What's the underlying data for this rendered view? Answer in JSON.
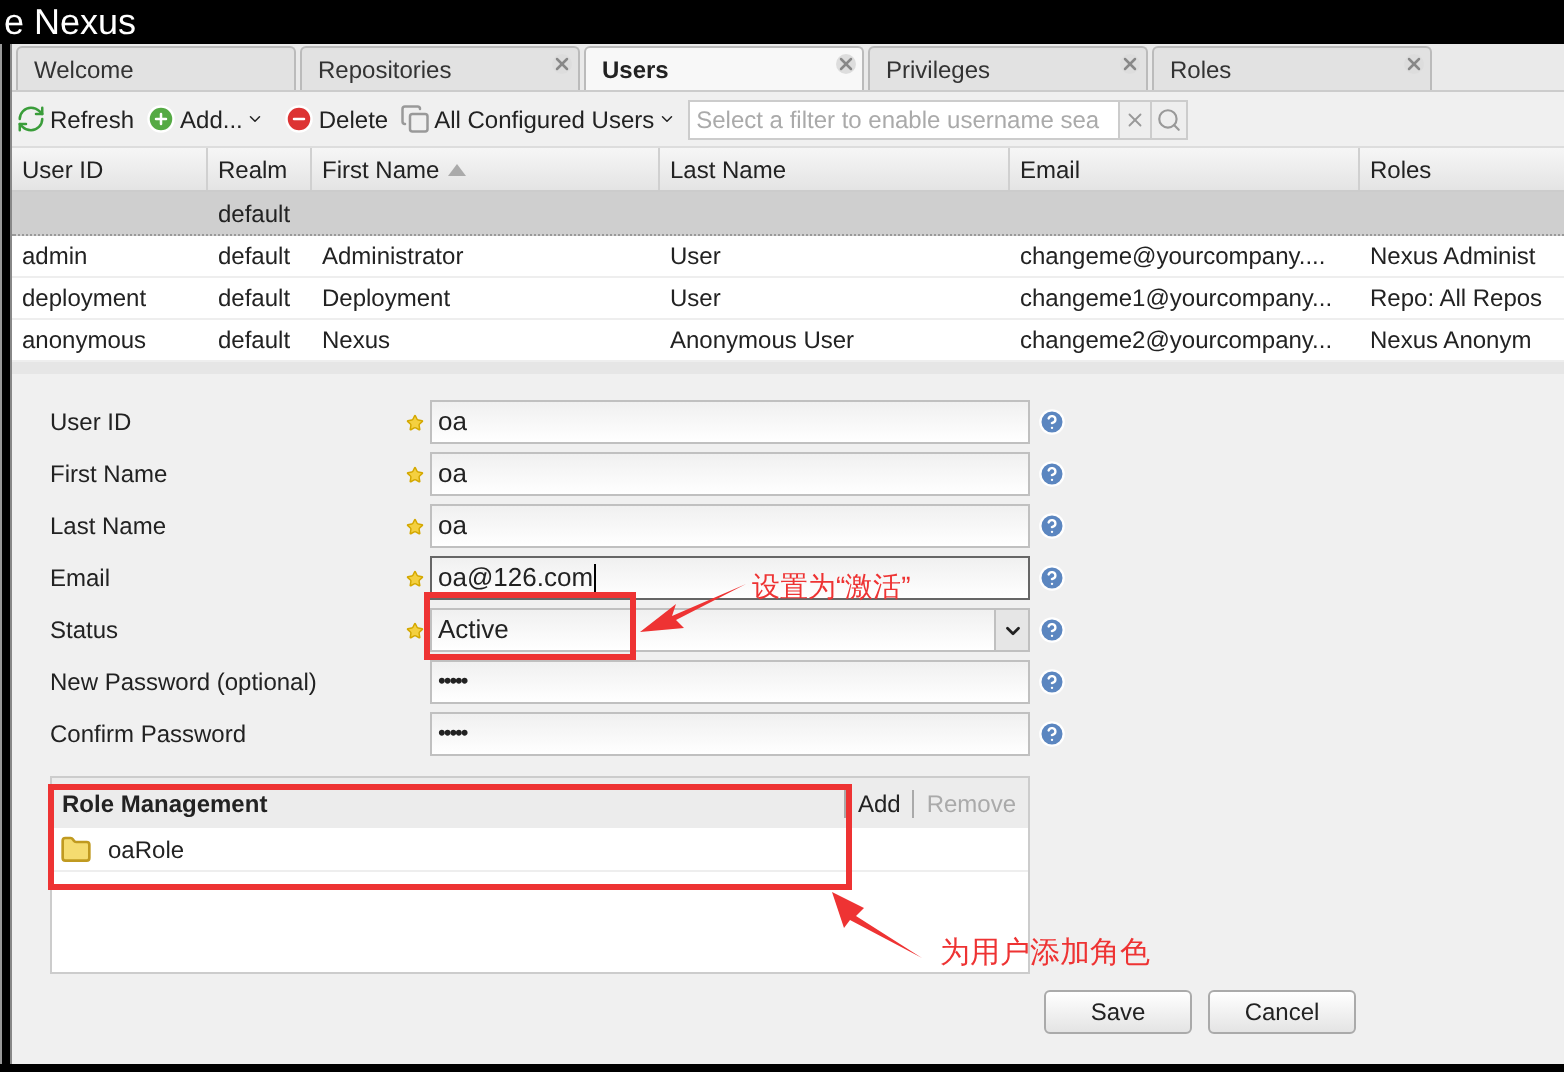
{
  "app_title": "e Nexus",
  "tabs": [
    {
      "label": "Welcome",
      "selected": false,
      "closable": false
    },
    {
      "label": "Repositories",
      "selected": false,
      "closable": true
    },
    {
      "label": "Users",
      "selected": true,
      "closable": true
    },
    {
      "label": "Privileges",
      "selected": false,
      "closable": true
    },
    {
      "label": "Roles",
      "selected": false,
      "closable": true
    }
  ],
  "toolbar": {
    "refresh": "Refresh",
    "add": "Add...",
    "delete": "Delete",
    "filter": "All Configured Users",
    "search": {
      "placeholder": "Select a filter to enable username sea"
    }
  },
  "table": {
    "columns": [
      {
        "label": "User ID",
        "sorted": false
      },
      {
        "label": "Realm",
        "sorted": false
      },
      {
        "label": "First Name",
        "sorted": true
      },
      {
        "label": "Last Name",
        "sorted": false
      },
      {
        "label": "Email",
        "sorted": false
      },
      {
        "label": "Roles",
        "sorted": false
      }
    ],
    "group_row": "default",
    "rows": [
      [
        "admin",
        "default",
        "Administrator",
        "User",
        "changeme@yourcompany....",
        "Nexus Administ"
      ],
      [
        "deployment",
        "default",
        "Deployment",
        "User",
        "changeme1@yourcompany...",
        "Repo: All Repos"
      ],
      [
        "anonymous",
        "default",
        "Nexus",
        "Anonymous User",
        "changeme2@yourcompany...",
        "Nexus Anonym"
      ]
    ]
  },
  "form": {
    "fields": [
      {
        "label": "User ID",
        "required": true,
        "kind": "text",
        "value": "oa",
        "focused": false
      },
      {
        "label": "First Name",
        "required": true,
        "kind": "text",
        "value": "oa",
        "focused": false
      },
      {
        "label": "Last Name",
        "required": true,
        "kind": "text",
        "value": "oa",
        "focused": false
      },
      {
        "label": "Email",
        "required": true,
        "kind": "text",
        "value": "oa@126.com",
        "focused": true
      },
      {
        "label": "Status",
        "required": true,
        "kind": "select",
        "value": "Active",
        "focused": false
      },
      {
        "label": "New Password (optional)",
        "required": false,
        "kind": "password",
        "value": "•••••",
        "focused": false
      },
      {
        "label": "Confirm Password",
        "required": false,
        "kind": "password",
        "value": "•••••",
        "focused": false
      }
    ]
  },
  "roles": {
    "title": "Role Management",
    "add": "Add",
    "remove": "Remove",
    "remove_disabled": true,
    "items": [
      "oaRole"
    ]
  },
  "buttons": [
    "Save",
    "Cancel"
  ],
  "annotations": [
    {
      "text": "设置为“激活”"
    },
    {
      "text": "为用户添加角色"
    }
  ]
}
